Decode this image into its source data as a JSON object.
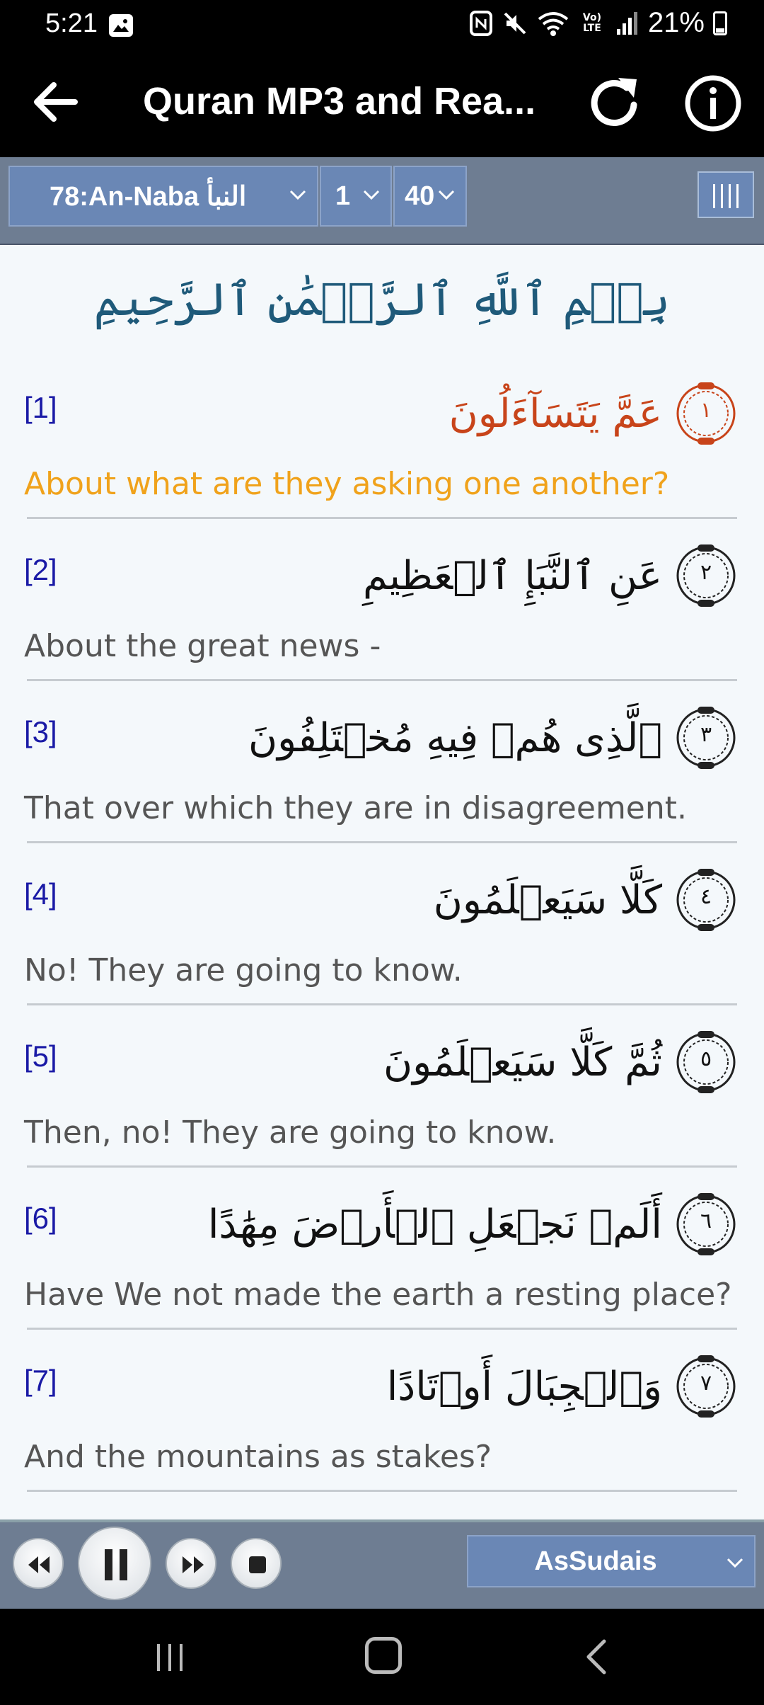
{
  "status_bar": {
    "time": "5:21",
    "battery": "21%",
    "network_label": "Vo) LTE"
  },
  "app_bar": {
    "title": "Quran MP3 and Rea..."
  },
  "toolbar": {
    "surah_select": "78:An-Naba النبأ",
    "ayah_from": "1",
    "ayah_to": "40"
  },
  "bismillah": "بِسۡمِ ٱللَّهِ ٱلرَّحۡمَٰنِ ٱلرَّحِيمِ",
  "verses": [
    {
      "num": "[1]",
      "arabic": "عَمَّ يَتَسَآءَلُونَ",
      "marker": "١",
      "translation": "About what are they asking one another?"
    },
    {
      "num": "[2]",
      "arabic": "عَنِ ٱلنَّبَإِ ٱلۡعَظِيمِ",
      "marker": "٢",
      "translation": "About the great news -"
    },
    {
      "num": "[3]",
      "arabic": "ٱلَّذِى هُمۡ فِيهِ مُخۡتَلِفُونَ",
      "marker": "٣",
      "translation": "That over which they are in disagreement."
    },
    {
      "num": "[4]",
      "arabic": "كَلَّا سَيَعۡلَمُونَ",
      "marker": "٤",
      "translation": "No! They are going to know."
    },
    {
      "num": "[5]",
      "arabic": "ثُمَّ كَلَّا سَيَعۡلَمُونَ",
      "marker": "٥",
      "translation": "Then, no! They are going to know."
    },
    {
      "num": "[6]",
      "arabic": "أَلَمۡ نَجۡعَلِ ٱلۡأَرۡضَ مِهَٰدًا",
      "marker": "٦",
      "translation": "Have We not made the earth a resting place?"
    },
    {
      "num": "[7]",
      "arabic": "وَٱلۡجِبَالَ أَوۡتَادًا",
      "marker": "٧",
      "translation": "And the mountains as stakes?"
    }
  ],
  "player": {
    "reciter": "AsSudais"
  },
  "colors": {
    "active_arabic": "#c8441a",
    "active_translation": "#f0a21b",
    "verse_number": "#1a1aa6",
    "toolbar_bg": "#6e7d92",
    "select_bg": "#6a87b5"
  },
  "icons": {
    "back": "arrow-left-icon",
    "refresh": "refresh-icon",
    "info": "info-icon",
    "menu": "columns-menu-icon",
    "rewind": "rewind-icon",
    "pause": "pause-icon",
    "fast_forward": "fast-forward-icon",
    "stop": "stop-icon"
  }
}
